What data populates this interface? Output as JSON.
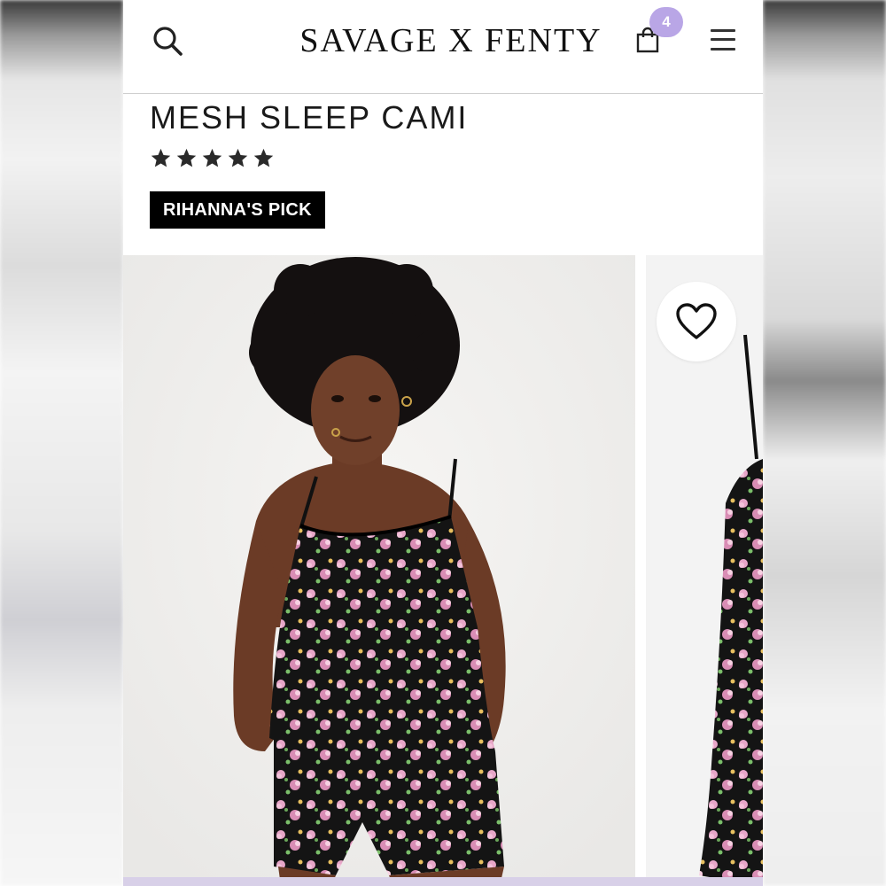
{
  "header": {
    "brand": "SAVAGE X FENTY",
    "cart_count": "4",
    "icons": {
      "search": "search-icon",
      "cart": "shopping-bag-icon",
      "menu": "hamburger-menu-icon"
    }
  },
  "product": {
    "title": "MESH SLEEP CAMI",
    "rating": 5,
    "rating_max": 5,
    "badge": "RIHANNA'S PICK"
  },
  "gallery": {
    "favorite_icon": "heart-icon",
    "images": [
      "model-wearing-floral-mesh-cami",
      "floral-mesh-cami-product"
    ]
  },
  "colors": {
    "badge_bg": "#000000",
    "cart_badge": "#b9a6e6",
    "text": "#1a1a1a"
  }
}
